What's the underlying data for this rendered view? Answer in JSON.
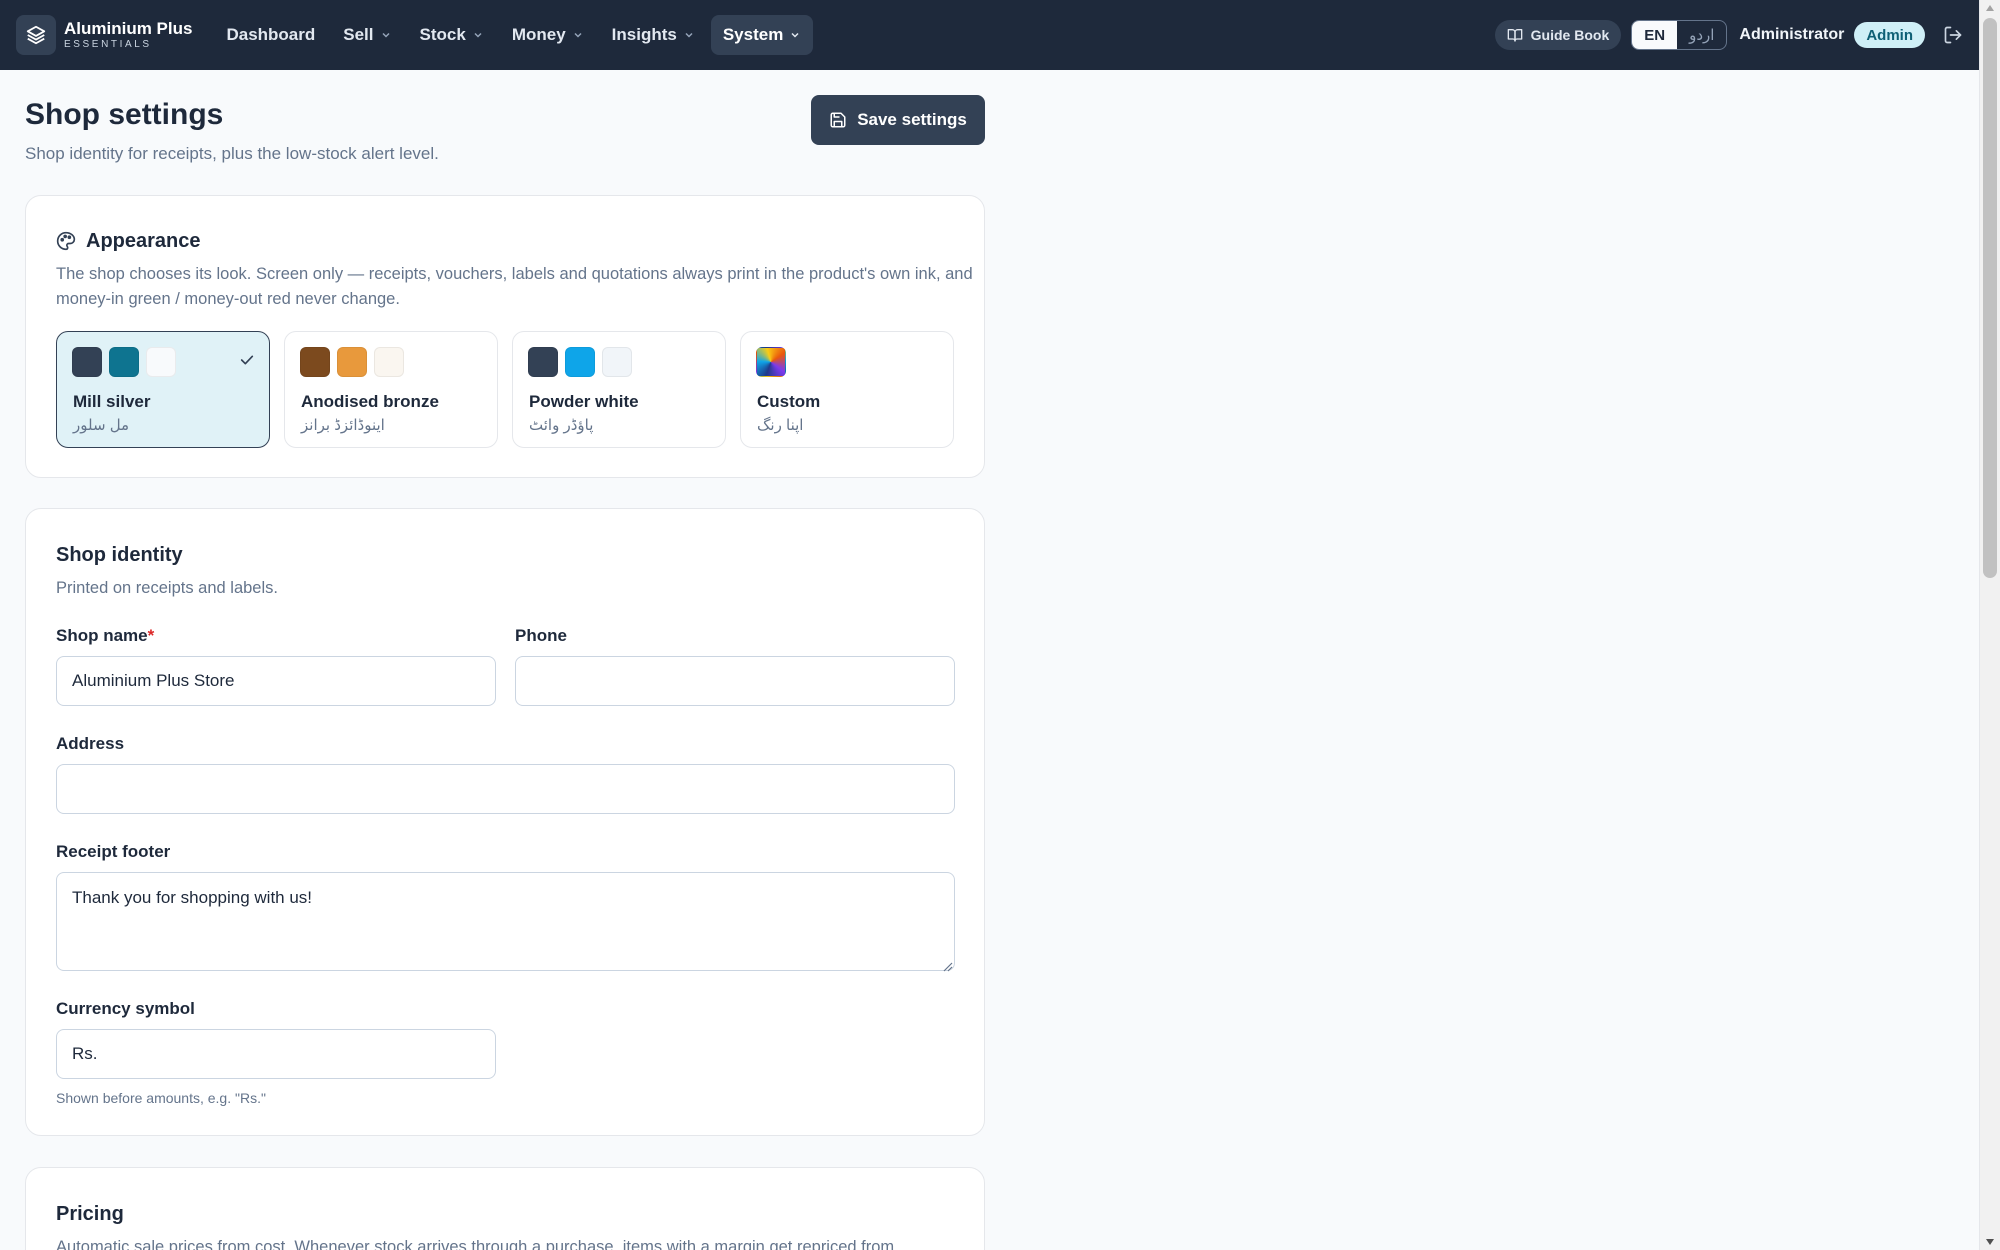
{
  "app": {
    "name": "Aluminium Plus",
    "subtitle": "ESSENTIALS"
  },
  "nav": {
    "items": [
      {
        "label": "Dashboard",
        "dropdown": false,
        "active": false
      },
      {
        "label": "Sell",
        "dropdown": true,
        "active": false
      },
      {
        "label": "Stock",
        "dropdown": true,
        "active": false
      },
      {
        "label": "Money",
        "dropdown": true,
        "active": false
      },
      {
        "label": "Insights",
        "dropdown": true,
        "active": false
      },
      {
        "label": "System",
        "dropdown": true,
        "active": true
      }
    ]
  },
  "header_right": {
    "guide_label": "Guide Book",
    "lang_en": "EN",
    "lang_ur": "اردو",
    "user_name": "Administrator",
    "role": "Admin"
  },
  "page": {
    "title": "Shop settings",
    "subtitle": "Shop identity for receipts, plus the low-stock alert level.",
    "save_label": "Save settings"
  },
  "appearance": {
    "title": "Appearance",
    "description": "The shop chooses its look. Screen only — receipts, vouchers, labels and quotations always print in the product's own ink, and money-in green / money-out red never change.",
    "themes": [
      {
        "name": "Mill silver",
        "urdu": "مل سلور",
        "selected": true,
        "colors": [
          "#334155",
          "#0e7490",
          "#f8fafc"
        ]
      },
      {
        "name": "Anodised bronze",
        "urdu": "اینوڈائزڈ برانز",
        "selected": false,
        "colors": [
          "#7c4a1e",
          "#e8993c",
          "#faf6f0"
        ]
      },
      {
        "name": "Powder white",
        "urdu": "پاؤڈر وائٹ",
        "selected": false,
        "colors": [
          "#334155",
          "#0ea5e9",
          "#f1f5f9"
        ]
      },
      {
        "name": "Custom",
        "urdu": "اپنا رنگ",
        "selected": false,
        "colors": []
      }
    ]
  },
  "identity": {
    "title": "Shop identity",
    "description": "Printed on receipts and labels.",
    "shop_name_label": "Shop name",
    "required_mark": "*",
    "shop_name_value": "Aluminium Plus Store",
    "phone_label": "Phone",
    "phone_value": "",
    "address_label": "Address",
    "address_value": "",
    "footer_label": "Receipt footer",
    "footer_value": "Thank you for shopping with us!",
    "currency_label": "Currency symbol",
    "currency_value": "Rs.",
    "currency_hint": "Shown before amounts, e.g. \"Rs.\""
  },
  "pricing": {
    "title": "Pricing",
    "description": "Automatic sale prices from cost. Whenever stock arrives through a purchase, items with a margin get repriced from"
  }
}
